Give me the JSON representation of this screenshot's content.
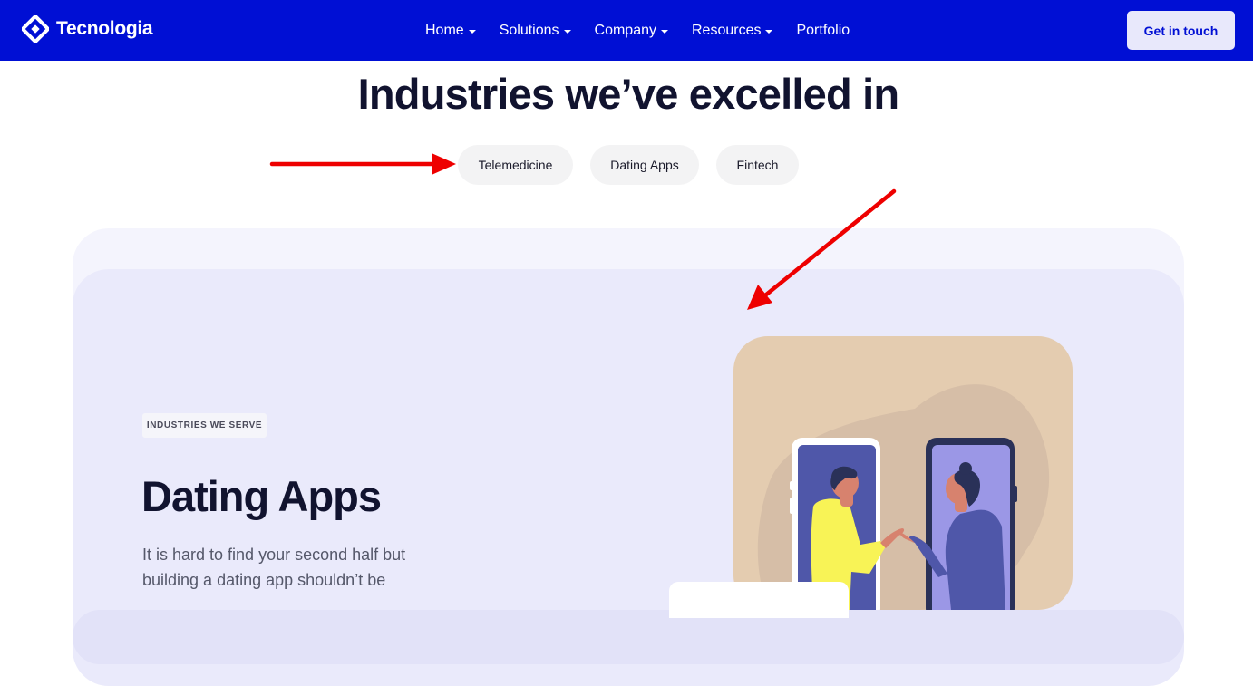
{
  "header": {
    "brand": "Tecnologia",
    "nav": [
      {
        "label": "Home",
        "dropdown": true
      },
      {
        "label": "Solutions",
        "dropdown": true
      },
      {
        "label": "Company",
        "dropdown": true
      },
      {
        "label": "Resources",
        "dropdown": true
      },
      {
        "label": "Portfolio",
        "dropdown": false
      }
    ],
    "cta_label": "Get in touch"
  },
  "section": {
    "heading": "Industries we’ve excelled in",
    "tabs": [
      "Telemedicine",
      "Dating Apps",
      "Fintech"
    ]
  },
  "panel": {
    "badge": "INDUSTRIES WE SERVE",
    "title": "Dating Apps",
    "description": "It is hard to find your second half but building a dating app shouldn’t be"
  },
  "colors": {
    "brand": "#000fd4",
    "annotation": "#ee0000",
    "panel": "#eaeafb"
  },
  "icons": [
    "logo-icon",
    "chevron-down-icon",
    "arrow-annotation"
  ]
}
